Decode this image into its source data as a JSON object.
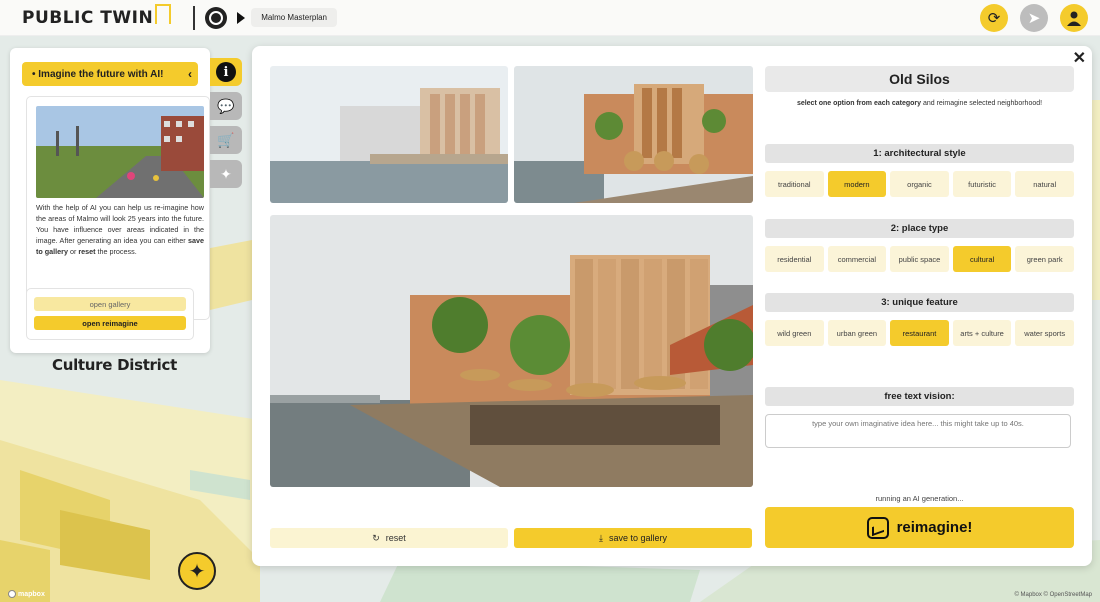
{
  "app": {
    "logo_text": "PUBLIC TWIN",
    "project_name": "Malmo Masterplan"
  },
  "top_actions": {
    "refresh_icon": "refresh-icon",
    "locate_icon": "location-arrow-icon",
    "user_icon": "user-icon"
  },
  "left_panel": {
    "header": "• Imagine the future with AI!",
    "description_parts": [
      "With the help of AI you can help us re-imagine how the areas of Malmo will look 25 years into the future. You have influence over areas indicated in the image. After generating an idea you can either ",
      "save to gallery",
      " or ",
      "reset",
      " the process."
    ],
    "open_gallery": "open gallery",
    "open_reimagine": "open reimagine",
    "district_label": "Culture District"
  },
  "side_tabs": [
    "info-icon",
    "chat-icon",
    "cart-icon",
    "sparkles-icon"
  ],
  "modal": {
    "title": "Old Silos",
    "subtitle_bold": "select one option from each category",
    "subtitle_rest": " and reimagine selected neighborhood!",
    "categories": [
      {
        "heading": "1: architectural style",
        "options": [
          "traditional",
          "modern",
          "organic",
          "futuristic",
          "natural"
        ],
        "selected": "modern"
      },
      {
        "heading": "2: place type",
        "options": [
          "residential",
          "commercial",
          "public space",
          "cultural",
          "green park"
        ],
        "selected": "cultural"
      },
      {
        "heading": "3: unique feature",
        "options": [
          "wild green",
          "urban green",
          "restaurant",
          "arts + culture",
          "water sports"
        ],
        "selected": "restaurant"
      }
    ],
    "free_text_heading": "free text vision:",
    "free_text_placeholder": "type your own imaginative idea here... this might take up to 40s.",
    "status": "running an AI generation...",
    "reimagine_label": "reimagine!",
    "reset_label": "reset",
    "save_label": "save to gallery"
  },
  "map": {
    "credit": "© Mapbox © OpenStreetMap",
    "logo": "mapbox"
  },
  "colors": {
    "accent": "#f4cb2c",
    "accent_light": "#fbf4d8"
  }
}
